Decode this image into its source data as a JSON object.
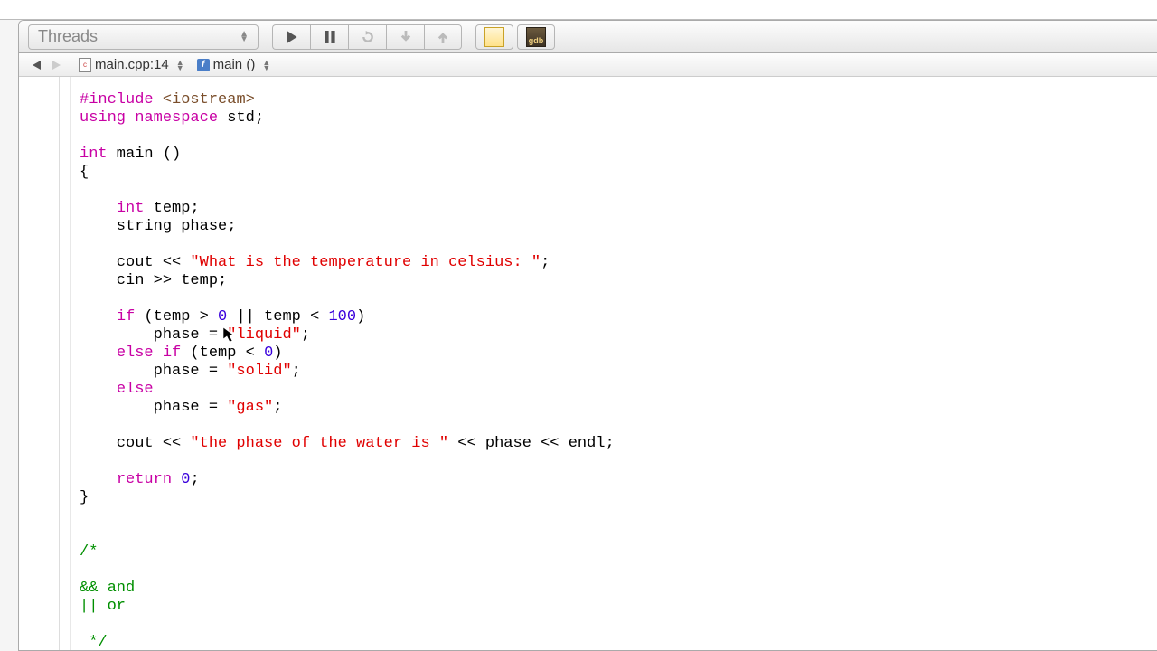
{
  "toolbar": {
    "threads_label": "Threads",
    "gdb_label": "gdb"
  },
  "nav": {
    "file_label": "main.cpp:14",
    "func_label": "main ()"
  },
  "code": {
    "l1_a": "#include",
    "l1_b": " <iostream>",
    "l2_a": "using",
    "l2_b": "namespace",
    "l2_c": " std;",
    "l4_a": "int",
    "l4_b": " main ()",
    "l5": "{",
    "l7_a": "    ",
    "l7_b": "int",
    "l7_c": " temp;",
    "l8_a": "    string phase;",
    "l10_a": "    cout << ",
    "l10_b": "\"What is the temperature in celsius: \"",
    "l10_c": ";",
    "l11_a": "    cin >> temp;",
    "l13_a": "    ",
    "l13_b": "if",
    "l13_c": " (temp > ",
    "l13_d": "0",
    "l13_e": " || temp < ",
    "l13_f": "100",
    "l13_g": ")",
    "l14_a": "        phase = ",
    "l14_b": "\"liquid\"",
    "l14_c": ";",
    "l15_a": "    ",
    "l15_b": "else",
    "l15_c": " ",
    "l15_d": "if",
    "l15_e": " (temp < ",
    "l15_f": "0",
    "l15_g": ")",
    "l16_a": "        phase = ",
    "l16_b": "\"solid\"",
    "l16_c": ";",
    "l17_a": "    ",
    "l17_b": "else",
    "l18_a": "        phase = ",
    "l18_b": "\"gas\"",
    "l18_c": ";",
    "l20_a": "    cout << ",
    "l20_b": "\"the phase of the water is \"",
    "l20_c": " << phase << endl;",
    "l22_a": "    ",
    "l22_b": "return",
    "l22_c": " ",
    "l22_d": "0",
    "l22_e": ";",
    "l23": "}",
    "l25": "/*",
    "l27": "&& and",
    "l28": "|| or",
    "l30": " */"
  }
}
